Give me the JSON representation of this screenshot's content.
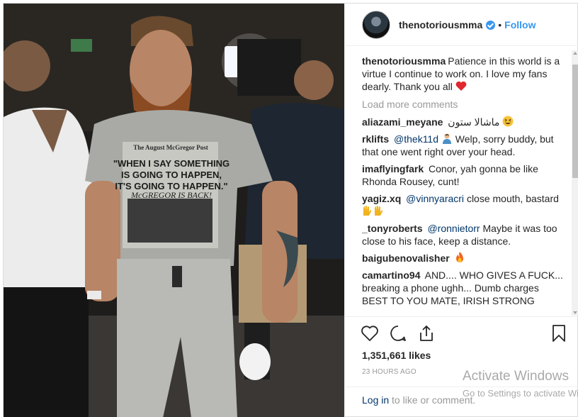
{
  "post": {
    "username": "thenotoriousmma",
    "dot": "•",
    "follow_label": "Follow",
    "caption_text": "Patience in this world is a virtue I continue to work on. I love my fans dearly. Thank you all",
    "load_more": "Load more comments",
    "comments": [
      {
        "user": "aliazami_meyane",
        "pre": "",
        "mention": "",
        "text": "ماشالا ستون",
        "emoji": "grinning-squinting-face-emoji"
      },
      {
        "user": "rklifts",
        "pre": "",
        "mention": "@thek11d",
        "text": "Welp, sorry buddy, but that one went right over your head.",
        "emoji": "person-emoji"
      },
      {
        "user": "imaflyingfark",
        "pre": "",
        "mention": "",
        "text": "Conor, yah gonna be like Rhonda Rousey, cunt!",
        "emoji": ""
      },
      {
        "user": "yagiz.xq",
        "pre": "",
        "mention": "@vinnyaracri",
        "text": "close mouth, bastard",
        "emoji": "raised-hands-emoji"
      },
      {
        "user": "_tonyroberts",
        "pre": "",
        "mention": "@ronnietorr",
        "text": "Maybe it was too close to his face, keep a distance.",
        "emoji": ""
      },
      {
        "user": "baigubenovalisher",
        "pre": "",
        "mention": "",
        "text": "",
        "emoji": "fire-emoji"
      },
      {
        "user": "camartino94",
        "pre": "",
        "mention": "",
        "text": "AND.... WHO GIVES A FUCK... breaking a phone ughh... Dumb charges BEST TO YOU MATE, IRISH STRONG",
        "emoji": ""
      }
    ],
    "likes": "1,351,661 likes",
    "time": "23 HOURS AGO",
    "login_link": "Log in",
    "login_rest": " to like or comment."
  },
  "shirt": {
    "masthead": "The August McGregor Post",
    "headline1": "\"WHEN I SAY SOMETHING",
    "headline2": "IS GOING TO HAPPEN,",
    "headline3": "IT'S GOING TO HAPPEN.\"",
    "headline4": "McGREGOR IS BACK!"
  },
  "watermark": {
    "line1": "Activate Windows",
    "line2": "Go to Settings to activate Windows."
  },
  "colors": {
    "accent": "#3897f0",
    "link": "#003569",
    "heart": "#ed4956",
    "muted": "#999999"
  },
  "icons": [
    "heart-icon",
    "comment-icon",
    "share-icon",
    "bookmark-icon",
    "verified-badge-icon"
  ]
}
